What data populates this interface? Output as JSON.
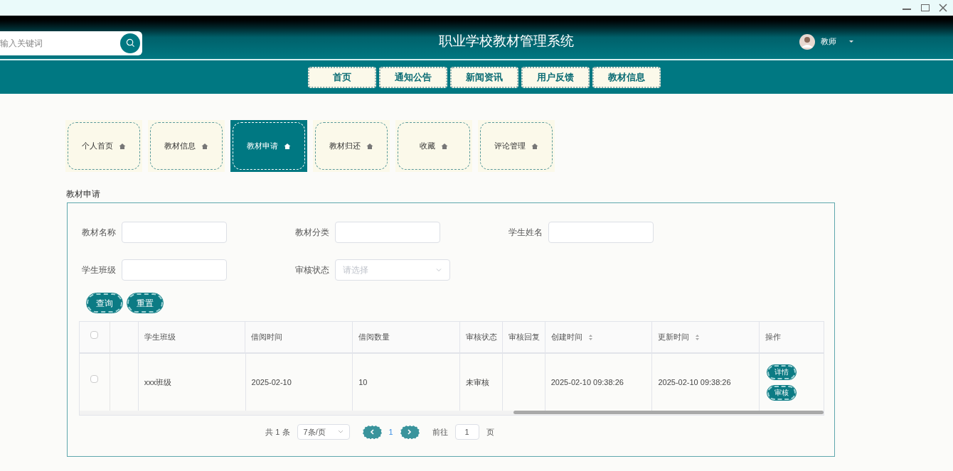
{
  "header": {
    "search": {
      "placeholder": "输入关键词"
    },
    "title": "职业学校教材管理系统",
    "user": {
      "name": "教师"
    }
  },
  "nav": [
    {
      "label": "首页"
    },
    {
      "label": "通知公告"
    },
    {
      "label": "新闻资讯"
    },
    {
      "label": "用户反馈"
    },
    {
      "label": "教材信息"
    }
  ],
  "tabs": [
    {
      "label": "个人首页",
      "selected": false
    },
    {
      "label": "教材信息",
      "selected": false
    },
    {
      "label": "教材申请",
      "selected": true
    },
    {
      "label": "教材归还",
      "selected": false
    },
    {
      "label": "收藏",
      "selected": false
    },
    {
      "label": "评论管理",
      "selected": false
    }
  ],
  "section_title": "教材申请",
  "filters": [
    {
      "label": "教材名称",
      "kind": "text"
    },
    {
      "label": "教材分类",
      "kind": "text"
    },
    {
      "label": "学生姓名",
      "kind": "text"
    },
    {
      "label": "学生班级",
      "kind": "text"
    },
    {
      "label": "审核状态",
      "kind": "select",
      "placeholder": "请选择"
    }
  ],
  "buttons": [
    "查询",
    "重置"
  ],
  "table": {
    "columns": [
      {
        "label": "学生班级",
        "sortable": false
      },
      {
        "label": "借阅时间",
        "sortable": false
      },
      {
        "label": "借阅数量",
        "sortable": false
      },
      {
        "label": "审核状态",
        "sortable": false
      },
      {
        "label": "审核回复",
        "sortable": false
      },
      {
        "label": "创建时间",
        "sortable": true
      },
      {
        "label": "更新时间",
        "sortable": true
      },
      {
        "label": "操作",
        "sortable": false
      }
    ],
    "rows": [
      {
        "checked": false,
        "cells": [
          "xxx班级",
          "2025-02-10",
          "10",
          "未审核",
          "",
          "2025-02-10 09:38:26",
          "2025-02-10 09:38:26"
        ],
        "actions": [
          "详情",
          "审核"
        ]
      }
    ],
    "header_checked": false
  },
  "pagination": {
    "total": "共 1 条",
    "page_size": "7条/页",
    "current": "1",
    "goto_label": "前往",
    "goto_value": "1",
    "page_suffix": "页"
  }
}
